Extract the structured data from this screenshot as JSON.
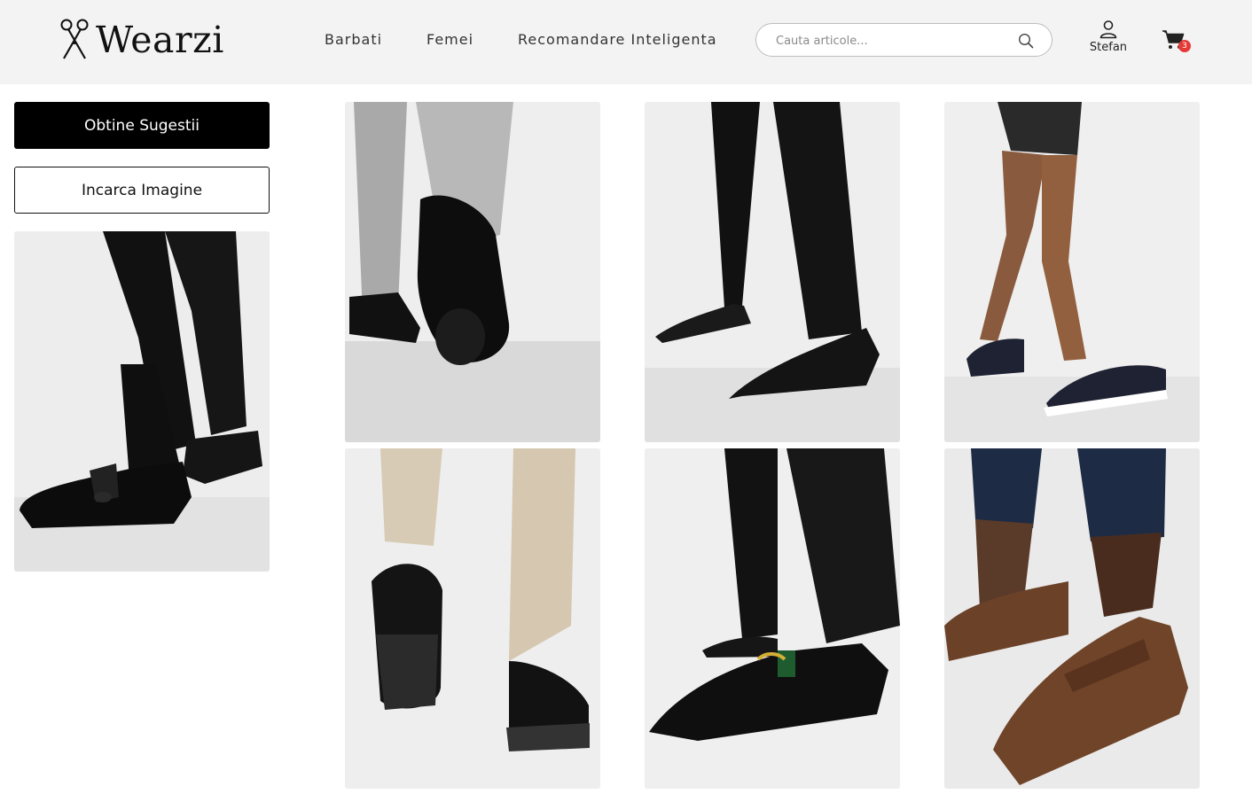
{
  "header": {
    "logo_text": "Wearzi",
    "nav": {
      "barbati": "Barbati",
      "femei": "Femei",
      "recomandare": "Recomandare Inteligenta"
    },
    "search": {
      "placeholder": "Cauta articole..."
    },
    "account": {
      "name": "Stefan",
      "icon": "user-icon"
    },
    "cart": {
      "count": "3",
      "icon": "cart-icon",
      "badge_color": "#e53935"
    }
  },
  "sidebar": {
    "suggest_button": "Obtine Sugestii",
    "upload_button": "Incarca Imagine",
    "preview_image": "black-tassel-loafer-photo"
  },
  "results": {
    "items": [
      "black-derby-shoes-grey-trousers-photo",
      "black-suede-tassel-loafers-photo",
      "navy-suede-tassel-loafers-photo",
      "black-chunky-loafers-beige-trousers-photo",
      "black-leather-snaffle-loafers-photo",
      "brown-suede-penny-loafers-photo"
    ]
  },
  "colors": {
    "primary": "#000000",
    "header_bg": "#f3f3f3"
  }
}
